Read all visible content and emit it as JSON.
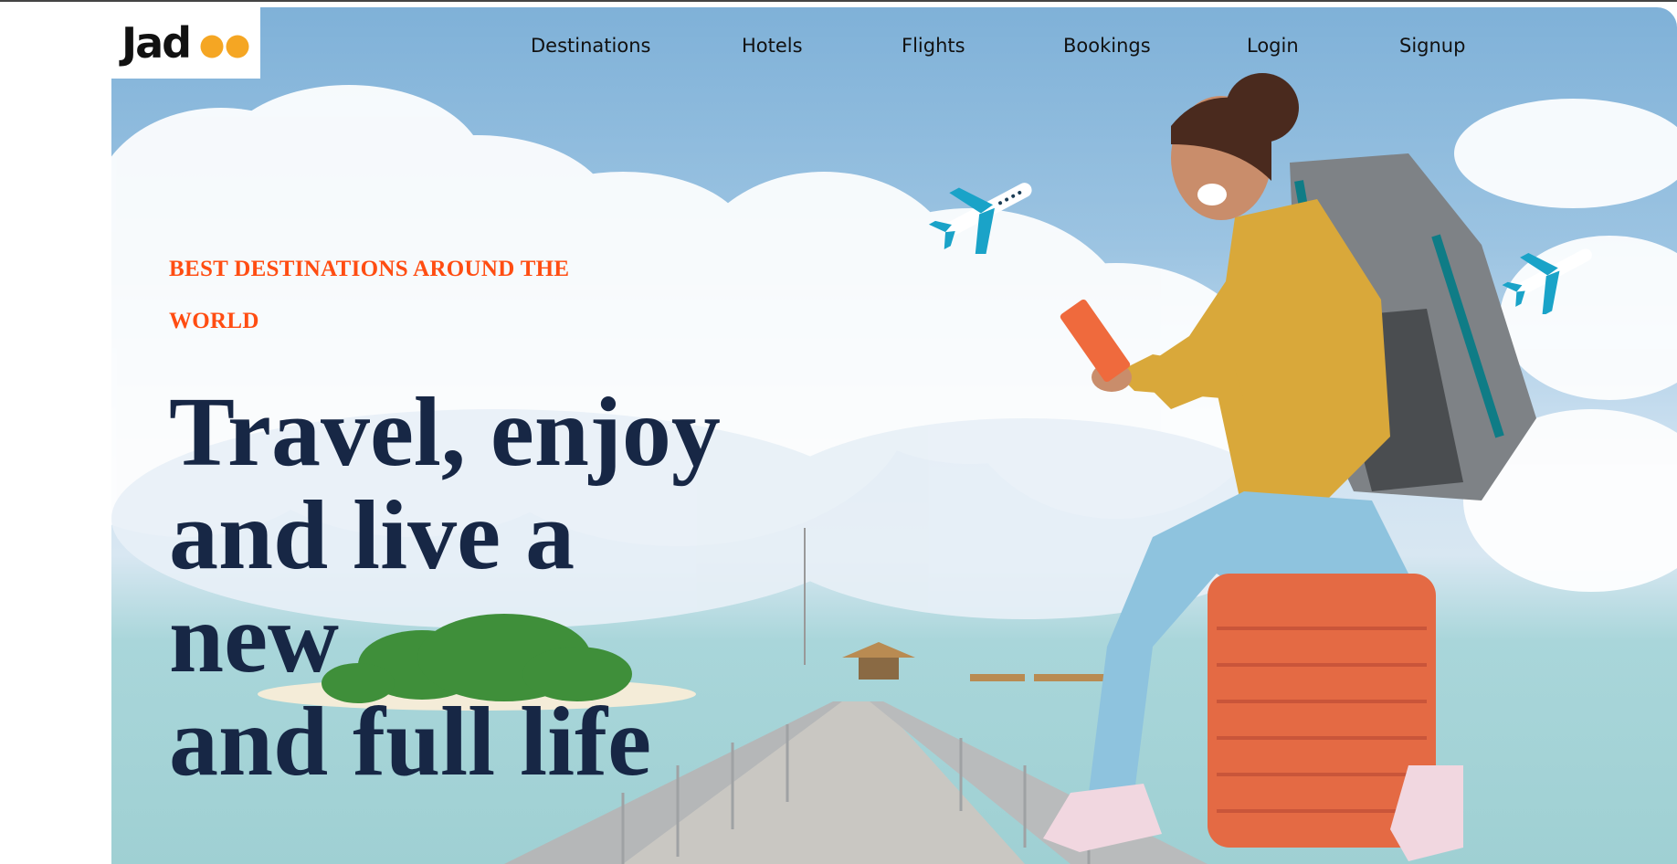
{
  "brand": {
    "logo_text": "Jadoo"
  },
  "nav": {
    "destinations": "Destinations",
    "hotels": "Hotels",
    "flights": "Flights",
    "bookings": "Bookings",
    "login": "Login",
    "signup": "Signup"
  },
  "hero": {
    "eyebrow_line1": "BEST DESTINATIONS AROUND THE",
    "eyebrow_line2": "WORLD",
    "headline_line1": "Travel, enjoy",
    "headline_line2": "and live a",
    "headline_line3": "new",
    "headline_line4": "and full life"
  },
  "colors": {
    "accent": "#ff4d12",
    "headline": "#172745",
    "logo_dots": "#f5a623"
  },
  "icons": [
    "airplane-icon",
    "airplane-icon"
  ]
}
